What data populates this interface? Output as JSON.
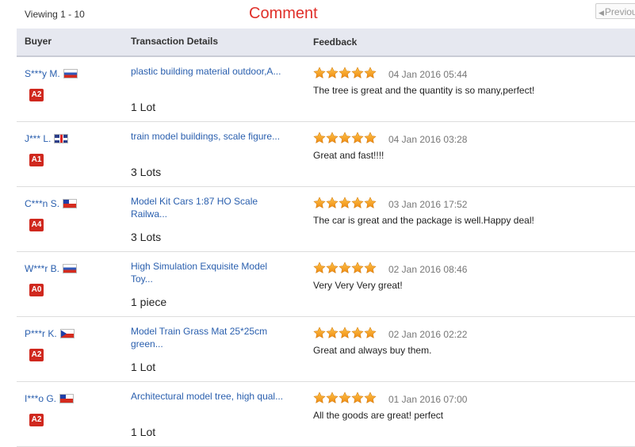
{
  "header": {
    "viewing": "Viewing 1 - 10",
    "section_title": "Comment",
    "prev_label": "Previous"
  },
  "table": {
    "columns": {
      "buyer": "Buyer",
      "transaction": "Transaction Details",
      "feedback": "Feedback"
    },
    "rows": [
      {
        "buyer": "S***y M.",
        "flag": "ru",
        "level": "A2",
        "product": "plastic building material outdoor,A...",
        "quantity": "1 Lot",
        "rating": 5,
        "date": "04 Jan 2016 05:44",
        "comment": "The tree is great and the quantity is so many,perfect!"
      },
      {
        "buyer": "J*** L.",
        "flag": "gb",
        "level": "A1",
        "product": "train model buildings, scale figure...",
        "quantity": "3 Lots",
        "rating": 5,
        "date": "04 Jan 2016 03:28",
        "comment": "Great and fast!!!!"
      },
      {
        "buyer": "C***n S.",
        "flag": "cl",
        "level": "A4",
        "product": "Model Kit Cars 1:87 HO Scale Railwa...",
        "quantity": "3 Lots",
        "rating": 5,
        "date": "03 Jan 2016 17:52",
        "comment": "The car is great and the package is well.Happy deal!"
      },
      {
        "buyer": "W***r B.",
        "flag": "ru",
        "level": "A0",
        "product": "High Simulation Exquisite Model Toy...",
        "quantity": "1 piece",
        "rating": 5,
        "date": "02 Jan 2016 08:46",
        "comment": "Very Very Very great!"
      },
      {
        "buyer": "P***r K.",
        "flag": "cz",
        "level": "A2",
        "product": "Model Train Grass Mat 25*25cm green...",
        "quantity": "1 Lot",
        "rating": 5,
        "date": "02 Jan 2016 02:22",
        "comment": "Great and always buy them."
      },
      {
        "buyer": "I***o G.",
        "flag": "cl",
        "level": "A2",
        "product": "Architectural model tree, high qual...",
        "quantity": "1 Lot",
        "rating": 5,
        "date": "01 Jan 2016 07:00",
        "comment": "All the goods are great! perfect"
      }
    ]
  },
  "colors": {
    "accent_red": "#e0302a",
    "link_blue": "#2a5fae",
    "star_orange": "#f39a1a",
    "header_bg": "#e6e8f0"
  }
}
